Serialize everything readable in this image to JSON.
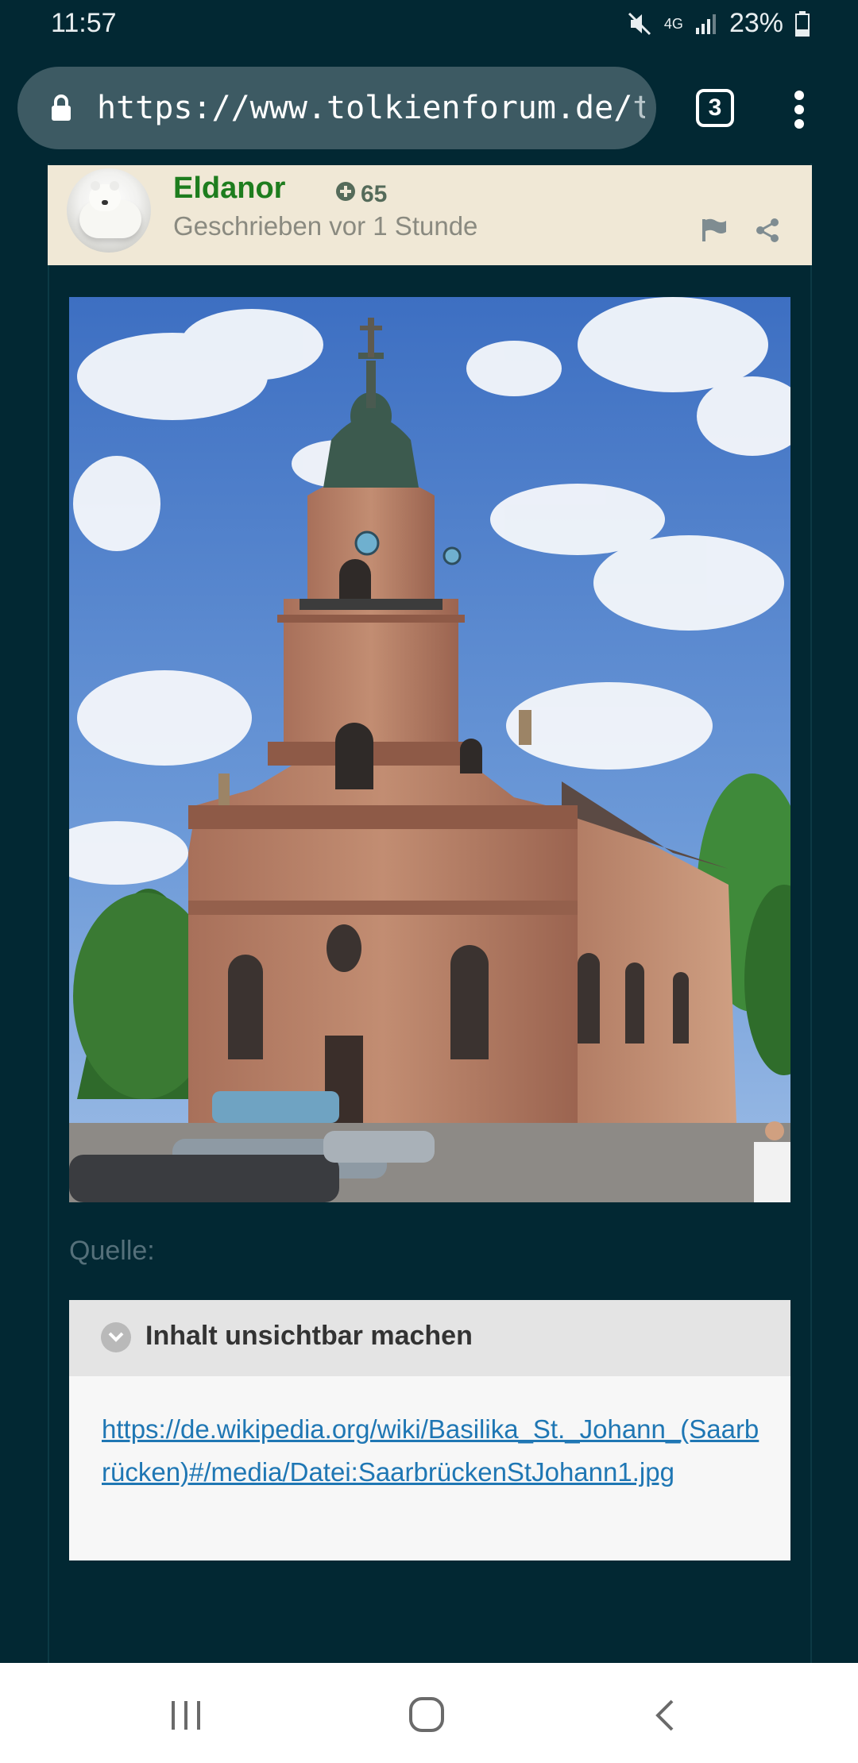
{
  "status_bar": {
    "time": "11:57",
    "network": "4G",
    "battery": "23%"
  },
  "browser": {
    "url_main": "https://www.tolkienforum.de/",
    "url_faded": "top",
    "tab_count": "3"
  },
  "post": {
    "author": "Eldanor",
    "reputation": "65",
    "date": "Geschrieben vor 1 Stunde",
    "source_label": "Quelle:",
    "spoiler_title": "Inhalt unsichtbar machen",
    "source_link": "https://de.wikipedia.org/wiki/Basilika_St._Johann_(Saarbrücken)#/media/Datei:SaarbrückenStJohann1.jpg"
  },
  "colors": {
    "background": "#022833",
    "author_green": "#1e7d1e",
    "header_bg": "#f0e8d6",
    "link_blue": "#1f77b4"
  },
  "icons": {
    "mute": "mute-icon",
    "signal": "signal-icon",
    "battery": "battery-icon",
    "lock": "lock-icon",
    "menu": "more-vert-icon",
    "flag": "flag-icon",
    "share": "share-icon",
    "chevron": "chevron-down-icon",
    "nav_recent": "recent-apps-icon",
    "nav_home": "home-icon",
    "nav_back": "back-icon"
  }
}
